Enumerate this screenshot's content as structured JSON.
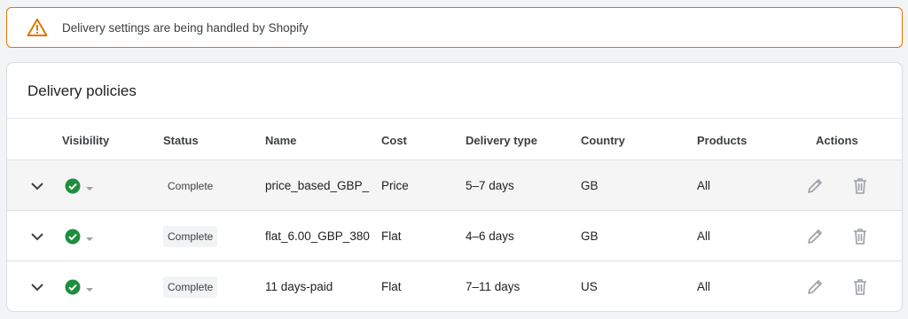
{
  "alert": {
    "icon": "warning-triangle-icon",
    "message": "Delivery settings are being handled by Shopify",
    "color": "#e37400"
  },
  "policies": {
    "title": "Delivery policies",
    "columns": {
      "visibility": "Visibility",
      "status": "Status",
      "name": "Name",
      "cost": "Cost",
      "delivery_type": "Delivery type",
      "country": "Country",
      "products": "Products",
      "actions": "Actions"
    },
    "rows": [
      {
        "status": "Complete",
        "name": "price_based_GBP_",
        "cost": "Price",
        "delivery_type": "5–7 days",
        "country": "GB",
        "products": "All"
      },
      {
        "status": "Complete",
        "name": "flat_6.00_GBP_380",
        "cost": "Flat",
        "delivery_type": "4–6 days",
        "country": "GB",
        "products": "All"
      },
      {
        "status": "Complete",
        "name": "11 days-paid",
        "cost": "Flat",
        "delivery_type": "7–11 days",
        "country": "US",
        "products": "All"
      }
    ]
  },
  "colors": {
    "visible_check": "#1e8e3e",
    "icon_gray": "#9aa0a6"
  }
}
